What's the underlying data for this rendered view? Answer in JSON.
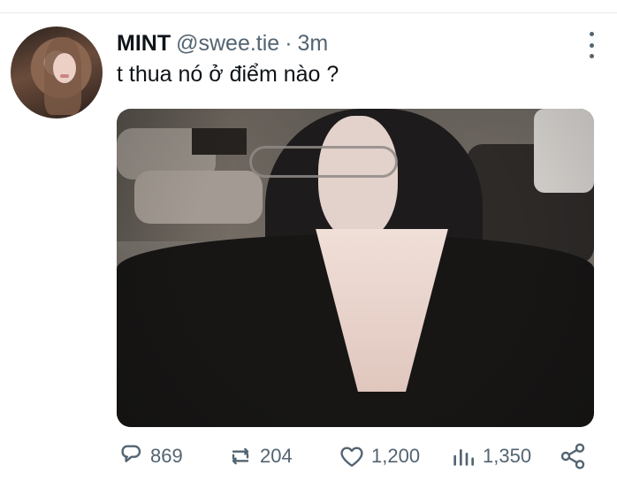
{
  "tweet": {
    "author_name": "MINT",
    "handle": "@swee.tie",
    "separator": "·",
    "time_ago": "3m",
    "text": "t thua nó ở điểm nào ?"
  },
  "actions": {
    "reply_count": "869",
    "retweet_count": "204",
    "like_count": "1,200",
    "view_count": "1,350"
  },
  "icons": {
    "more": "more-icon",
    "reply": "reply-icon",
    "retweet": "retweet-icon",
    "like": "heart-icon",
    "views": "analytics-icon",
    "share": "share-icon"
  },
  "colors": {
    "text": "#0f1419",
    "secondary": "#536471",
    "divider": "#e6ecf0"
  }
}
